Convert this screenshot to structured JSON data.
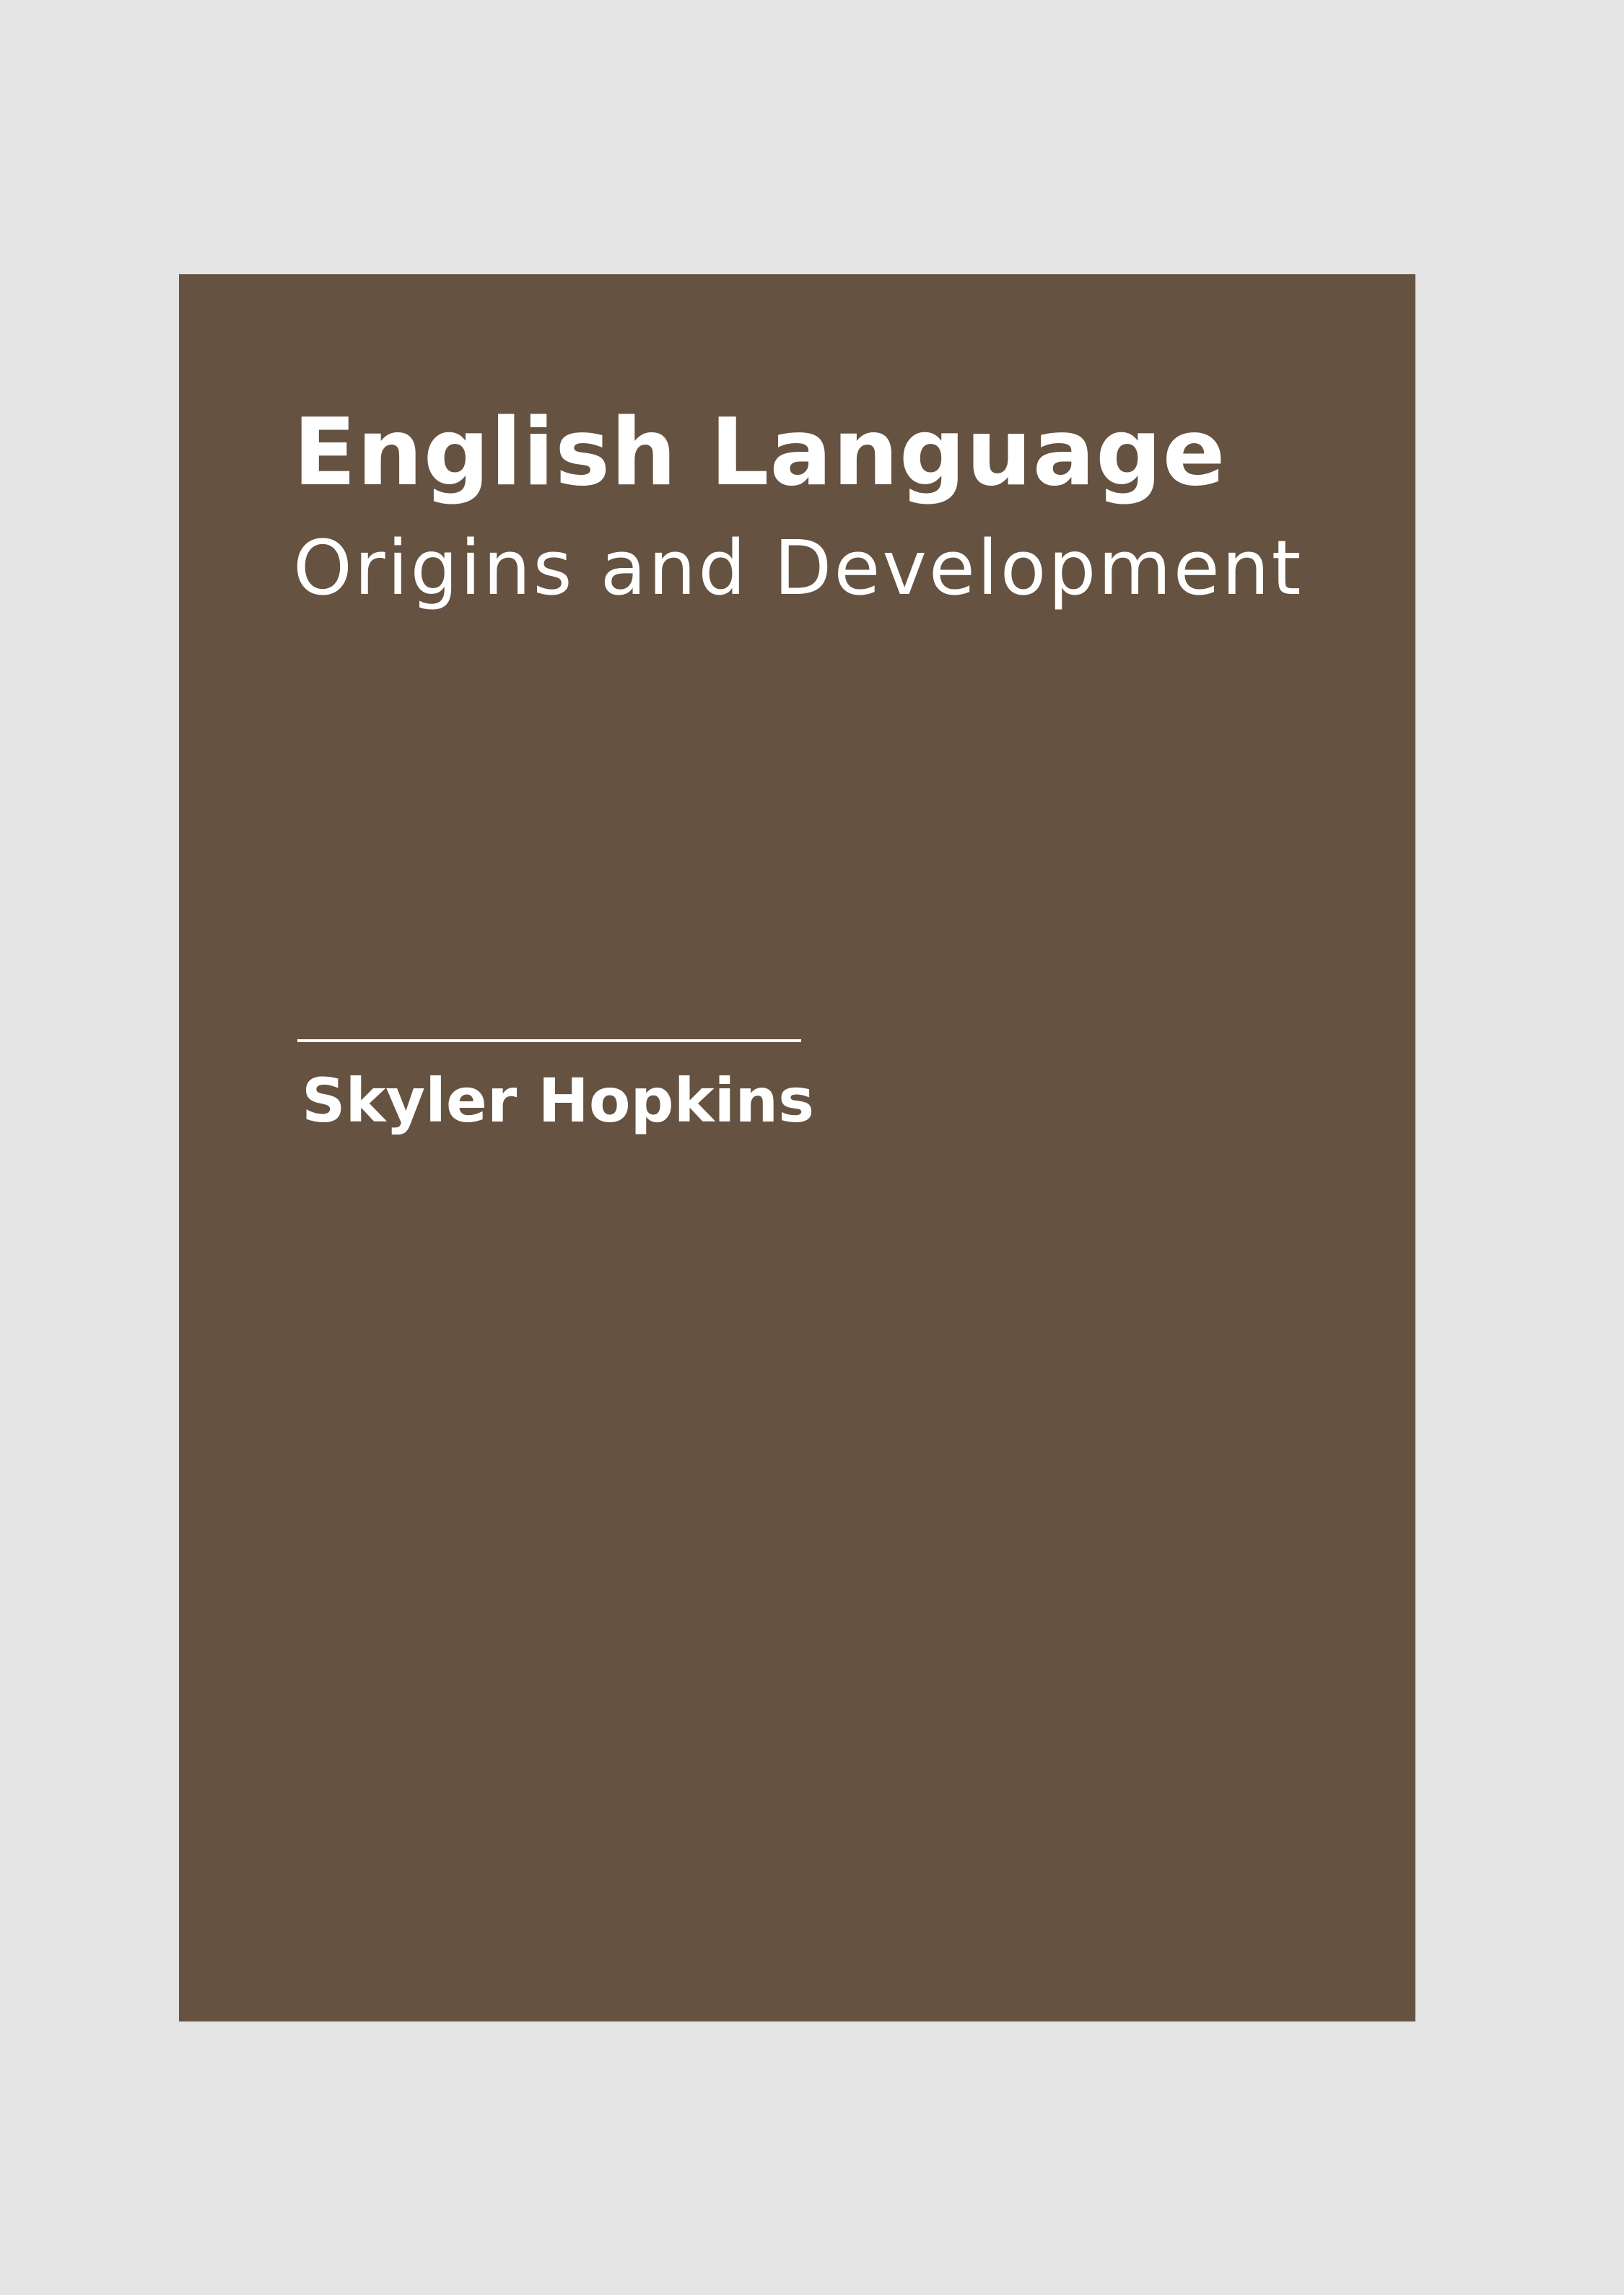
{
  "cover": {
    "title": "English Language",
    "subtitle": "Origins and Development",
    "author": "Skyler Hopkins"
  },
  "colors": {
    "page_background": "#e4e4e4",
    "cover_background": "#665240",
    "text": "#ffffff"
  }
}
